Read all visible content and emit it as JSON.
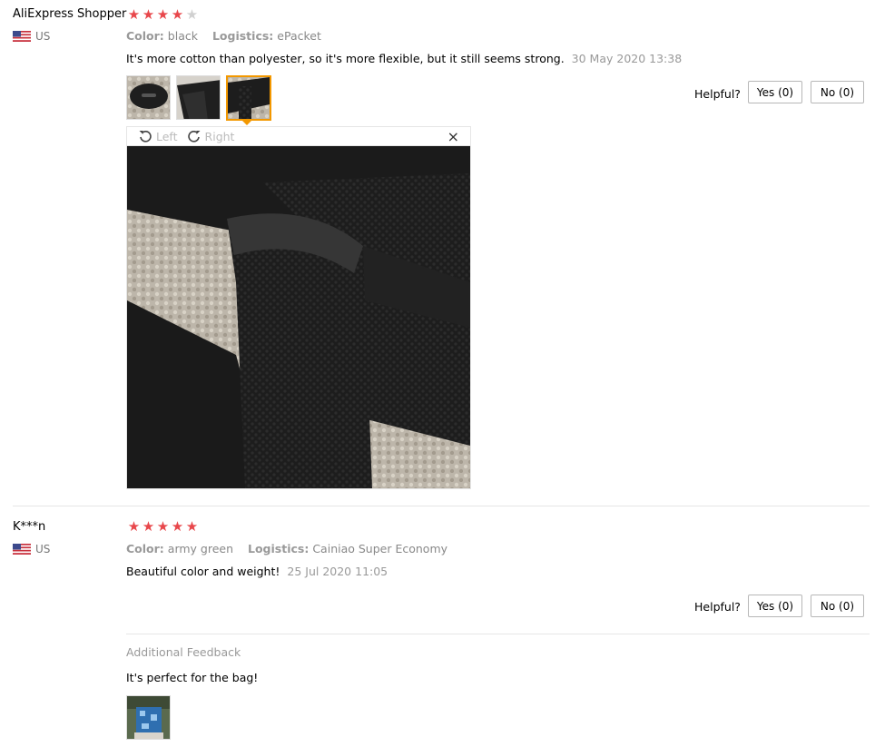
{
  "reviews": [
    {
      "user": "AliExpress Shopper",
      "rating": 4,
      "max_rating": 5,
      "country": "US",
      "attrs": [
        {
          "label": "Color:",
          "value": "black"
        },
        {
          "label": "Logistics:",
          "value": "ePacket"
        }
      ],
      "text": "It's more cotton than polyester, so it's more flexible, but it still seems strong.",
      "date": "30 May 2020 13:38",
      "helpful_label": "Helpful?",
      "yes_label": "Yes (0)",
      "no_label": "No (0)",
      "thumbnails": [
        "photo-1",
        "photo-2",
        "photo-3"
      ],
      "active_thumbnail": 3,
      "viewer": {
        "rotate_left_label": "Left",
        "rotate_right_label": "Right",
        "close_glyph": "×"
      }
    },
    {
      "user": "K***n",
      "rating": 5,
      "max_rating": 5,
      "country": "US",
      "attrs": [
        {
          "label": "Color:",
          "value": "army green"
        },
        {
          "label": "Logistics:",
          "value": "Cainiao Super Economy"
        }
      ],
      "text": "Beautiful color and weight!",
      "date": "25 Jul 2020 11:05",
      "helpful_label": "Helpful?",
      "yes_label": "Yes (0)",
      "no_label": "No (0)",
      "additional": {
        "title": "Additional Feedback",
        "text": "It's perfect for the bag!"
      }
    }
  ],
  "colors": {
    "star_on": "#e8474b",
    "star_off": "#d0d0d0",
    "active_thumb_border": "#f39800"
  },
  "icons": {
    "flag": "us-flag-icon",
    "rotate_left": "rotate-left-icon",
    "rotate_right": "rotate-right-icon",
    "close": "close-icon"
  }
}
